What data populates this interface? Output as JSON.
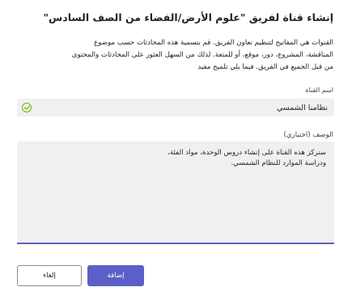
{
  "dialog": {
    "title": "إنشاء قناة لفريق \"علوم الأرض/الفضاء من الصف السادس\"",
    "description_lines": [
      "القنوات هي المفاتيح لتنظيم تعاون الفريق. قم بتسمية هذه المحادثات حسب موضوع",
      "المناقشة، المشروع، دور، موقع، أو للمتعة. لذلك من السهل العثور على المحادثات والمحتوى",
      "من قبل الجميع في الفريق. فيما يلي تلميح مفيد"
    ]
  },
  "channel_name": {
    "label": "اسم القناة",
    "value": "نظامنا الشمسي",
    "status_icon": "check-circle-icon",
    "status_color": "#6bb700"
  },
  "description_field": {
    "label": "الوصف (اختياري)",
    "value_lines": [
      "ستركز هذه القناة على إنشاء دروس الوحدة، مواد الفئة،",
      "ودراسة الموارد للنظام الشمسي."
    ],
    "focus_color": "#5b5fc7"
  },
  "buttons": {
    "add_label": "إضافة",
    "cancel_label": "إلغاء",
    "primary_color": "#5b5fc7"
  }
}
